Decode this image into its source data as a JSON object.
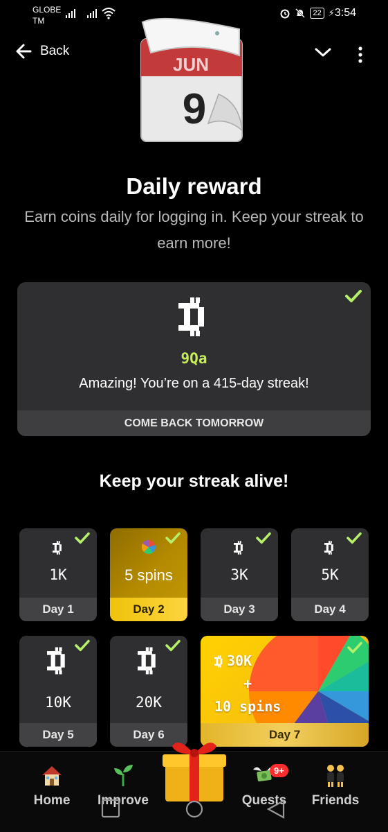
{
  "status_bar": {
    "carrier_line1": "GLOBE",
    "carrier_line2": "TM",
    "battery": "22",
    "time": "3:54"
  },
  "header": {
    "back_label": "Back",
    "icons": [
      "arrow-left-icon",
      "chevron-down-icon",
      "more-vertical-icon"
    ]
  },
  "title": "Daily reward",
  "subtitle": "Earn coins daily for logging in. Keep your streak to earn more!",
  "calendar": {
    "month": "JUN",
    "day": "9"
  },
  "reward": {
    "amount": "9Qa",
    "message": "Amazing! You’re on a 415-day streak!",
    "footer": "COME BACK TOMORROW"
  },
  "streak_title": "Keep your streak alive!",
  "days": [
    {
      "label": "Day 1",
      "reward": "1K"
    },
    {
      "label": "Day 2",
      "reward": "5 spins"
    },
    {
      "label": "Day 3",
      "reward": "3K"
    },
    {
      "label": "Day 4",
      "reward": "5K"
    },
    {
      "label": "Day 5",
      "reward": "10K"
    },
    {
      "label": "Day 6",
      "reward": "20K"
    },
    {
      "label": "Day 7",
      "reward_line1": "30K",
      "reward_plus": "+",
      "reward_line2": "10 spins"
    }
  ],
  "nav": [
    {
      "label": "Home"
    },
    {
      "label": "Improve"
    },
    {
      "label": "Quests",
      "badge": "9+"
    },
    {
      "label": "Friends"
    }
  ],
  "colors": {
    "background": "#000000",
    "card": "#2f2f31",
    "accent_green": "#c7ee5a",
    "check_green": "#b6f06a",
    "gold": "#f6c30f",
    "badge_red": "#ff2d2d"
  }
}
